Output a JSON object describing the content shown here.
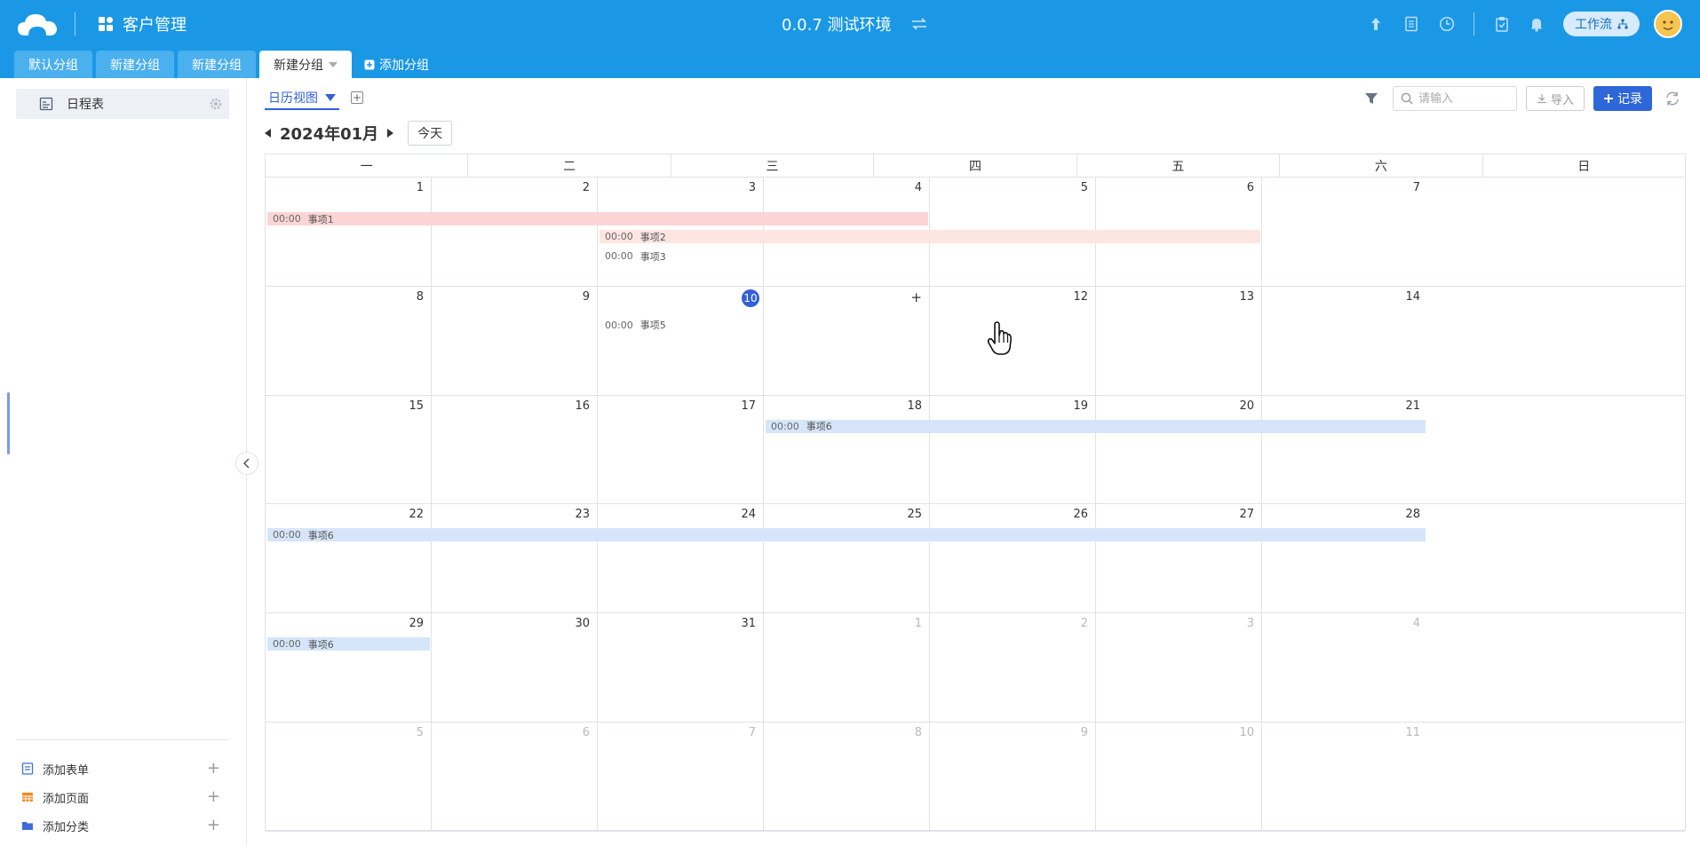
{
  "header": {
    "app_title": "客户管理",
    "env_title": "0.0.7 测试环境",
    "workflow_label": "工作流",
    "icons": [
      "upload-icon",
      "document-icon",
      "clock-icon",
      "clipboard-icon",
      "bell-icon",
      "swap-icon",
      "apps-icon",
      "avatar"
    ]
  },
  "tabs": [
    {
      "label": "默认分组",
      "active": false
    },
    {
      "label": "新建分组",
      "active": false
    },
    {
      "label": "新建分组",
      "active": false
    },
    {
      "label": "新建分组",
      "active": true
    }
  ],
  "add_group_label": "添加分组",
  "sidebar": {
    "items": [
      {
        "label": "日程表",
        "selected": true
      }
    ],
    "footer": [
      {
        "label": "添加表单"
      },
      {
        "label": "添加页面"
      },
      {
        "label": "添加分类"
      }
    ]
  },
  "toolbar": {
    "view_label": "日历视图",
    "month_label": "2024年01月",
    "today_label": "今天",
    "search_placeholder": "请输入",
    "import_label": "导入",
    "record_label": "记录"
  },
  "calendar": {
    "weekdays": [
      "一",
      "二",
      "三",
      "四",
      "五",
      "六",
      "日"
    ],
    "weeks": [
      [
        "1",
        "2",
        "3",
        "4",
        "5",
        "6",
        "7"
      ],
      [
        "8",
        "9",
        "10",
        "",
        "12",
        "13",
        "14"
      ],
      [
        "15",
        "16",
        "17",
        "18",
        "19",
        "20",
        "21"
      ],
      [
        "22",
        "23",
        "24",
        "25",
        "26",
        "27",
        "28"
      ],
      [
        "29",
        "30",
        "31",
        "1",
        "2",
        "3",
        "4"
      ],
      [
        "5",
        "6",
        "7",
        "8",
        "9",
        "10",
        "11"
      ]
    ],
    "today": "10",
    "hover_plus": "+",
    "events": [
      {
        "time": "00:00",
        "title": "事项1",
        "color": "#fbd5d5"
      },
      {
        "time": "00:00",
        "title": "事项2",
        "color": "#fde5e2"
      },
      {
        "time": "00:00",
        "title": "事项3",
        "color": ""
      },
      {
        "time": "00:00",
        "title": "事项5",
        "color": ""
      },
      {
        "time": "00:00",
        "title": "事项6",
        "color": "#d6e5fa"
      },
      {
        "time": "00:00",
        "title": "事项6",
        "color": "#d6e5fa"
      },
      {
        "time": "00:00",
        "title": "事项6",
        "color": "#d6e5fa"
      }
    ]
  },
  "colors": {
    "header_bg": "#1a98e6",
    "accent": "#3360d6",
    "tab_inactive": "#4ab0ee"
  }
}
